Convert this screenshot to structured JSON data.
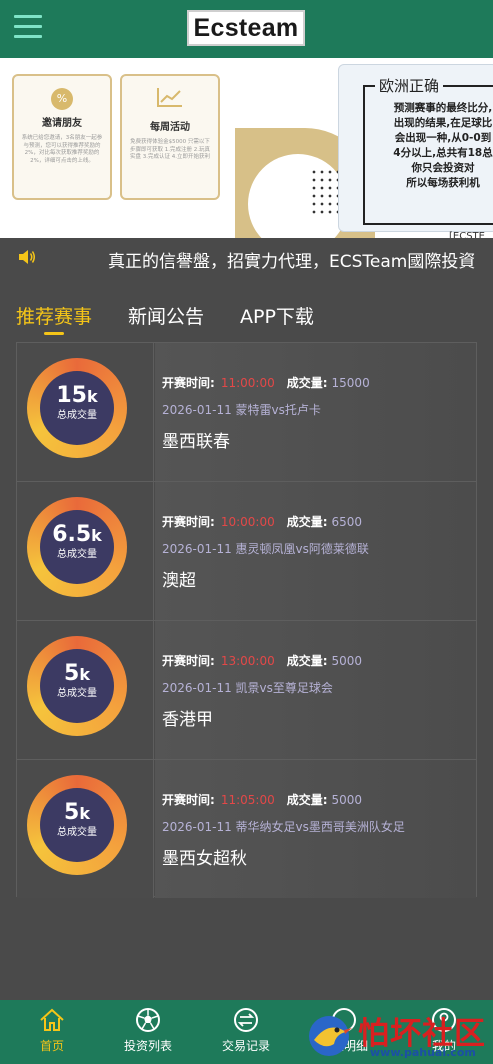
{
  "header": {
    "logo_text": "Ecsteam",
    "menu_icon": "hamburger-menu-icon"
  },
  "banner": {
    "card1": {
      "title": "邀请朋友",
      "text": "系统已给您邀请，3名朋友一起参与预测，您可以获得推荐奖励的2%，对比每次获取推荐奖励的2%，详细可点击的上线。"
    },
    "card2": {
      "title": "每周活动",
      "text": "免费获得体验金$5000 只需以下步骤即可获取 1.完成注册 2.玩真实盘 3.完成认证 4.立即开始获利"
    },
    "info": {
      "title": "欧洲正确",
      "lines": [
        "预测赛事的最终比分,",
        "出现的结果,在足球比",
        "会出现一种,从0-0到",
        "4分以上,总共有18总",
        "你只会投资对",
        "所以每场获利机"
      ],
      "footer": "[ECSTE"
    }
  },
  "marquee": {
    "text": "真正的信譽盤，招實力代理，ECSTeam國際投資"
  },
  "tabs": [
    {
      "label": "推荐赛事",
      "active": true
    },
    {
      "label": "新闻公告",
      "active": false
    },
    {
      "label": "APP下载",
      "active": false
    }
  ],
  "matches": [
    {
      "volume_num": "15",
      "volume_unit": "k",
      "volume_label": "总成交量",
      "time_label": "开赛时间:",
      "time": "11:00:00",
      "vol_label": "成交量:",
      "vol": "15000",
      "teams": "2026-01-11 蒙特雷vs托卢卡",
      "league": "墨西联春"
    },
    {
      "volume_num": "6.5",
      "volume_unit": "k",
      "volume_label": "总成交量",
      "time_label": "开赛时间:",
      "time": "10:00:00",
      "vol_label": "成交量:",
      "vol": "6500",
      "teams": "2026-01-11 惠灵顿凤凰vs阿德莱德联",
      "league": "澳超"
    },
    {
      "volume_num": "5",
      "volume_unit": "k",
      "volume_label": "总成交量",
      "time_label": "开赛时间:",
      "time": "13:00:00",
      "vol_label": "成交量:",
      "vol": "5000",
      "teams": "2026-01-11 凯景vs至尊足球会",
      "league": "香港甲"
    },
    {
      "volume_num": "5",
      "volume_unit": "k",
      "volume_label": "总成交量",
      "time_label": "开赛时间:",
      "time": "11:05:00",
      "vol_label": "成交量:",
      "vol": "5000",
      "teams": "2026-01-11 蒂华纳女足vs墨西哥美洲队女足",
      "league": "墨西女超秋"
    }
  ],
  "bottom_nav": [
    {
      "label": "首页",
      "icon": "home-icon",
      "active": true
    },
    {
      "label": "投资列表",
      "icon": "soccer-ball-icon",
      "active": false
    },
    {
      "label": "交易记录",
      "icon": "exchange-icon",
      "active": false
    },
    {
      "label": "资金明细",
      "icon": "wallet-icon",
      "active": false
    },
    {
      "label": "我的",
      "icon": "user-icon",
      "active": false
    }
  ],
  "watermark": {
    "text": "怕坏社区",
    "url": "www.pahuai.com"
  },
  "colors": {
    "header_bg": "#1e7a5a",
    "page_bg": "#4a4a4a",
    "accent": "#f5c518",
    "time_red": "#e34848",
    "teams_lavender": "#b6b2d6"
  }
}
